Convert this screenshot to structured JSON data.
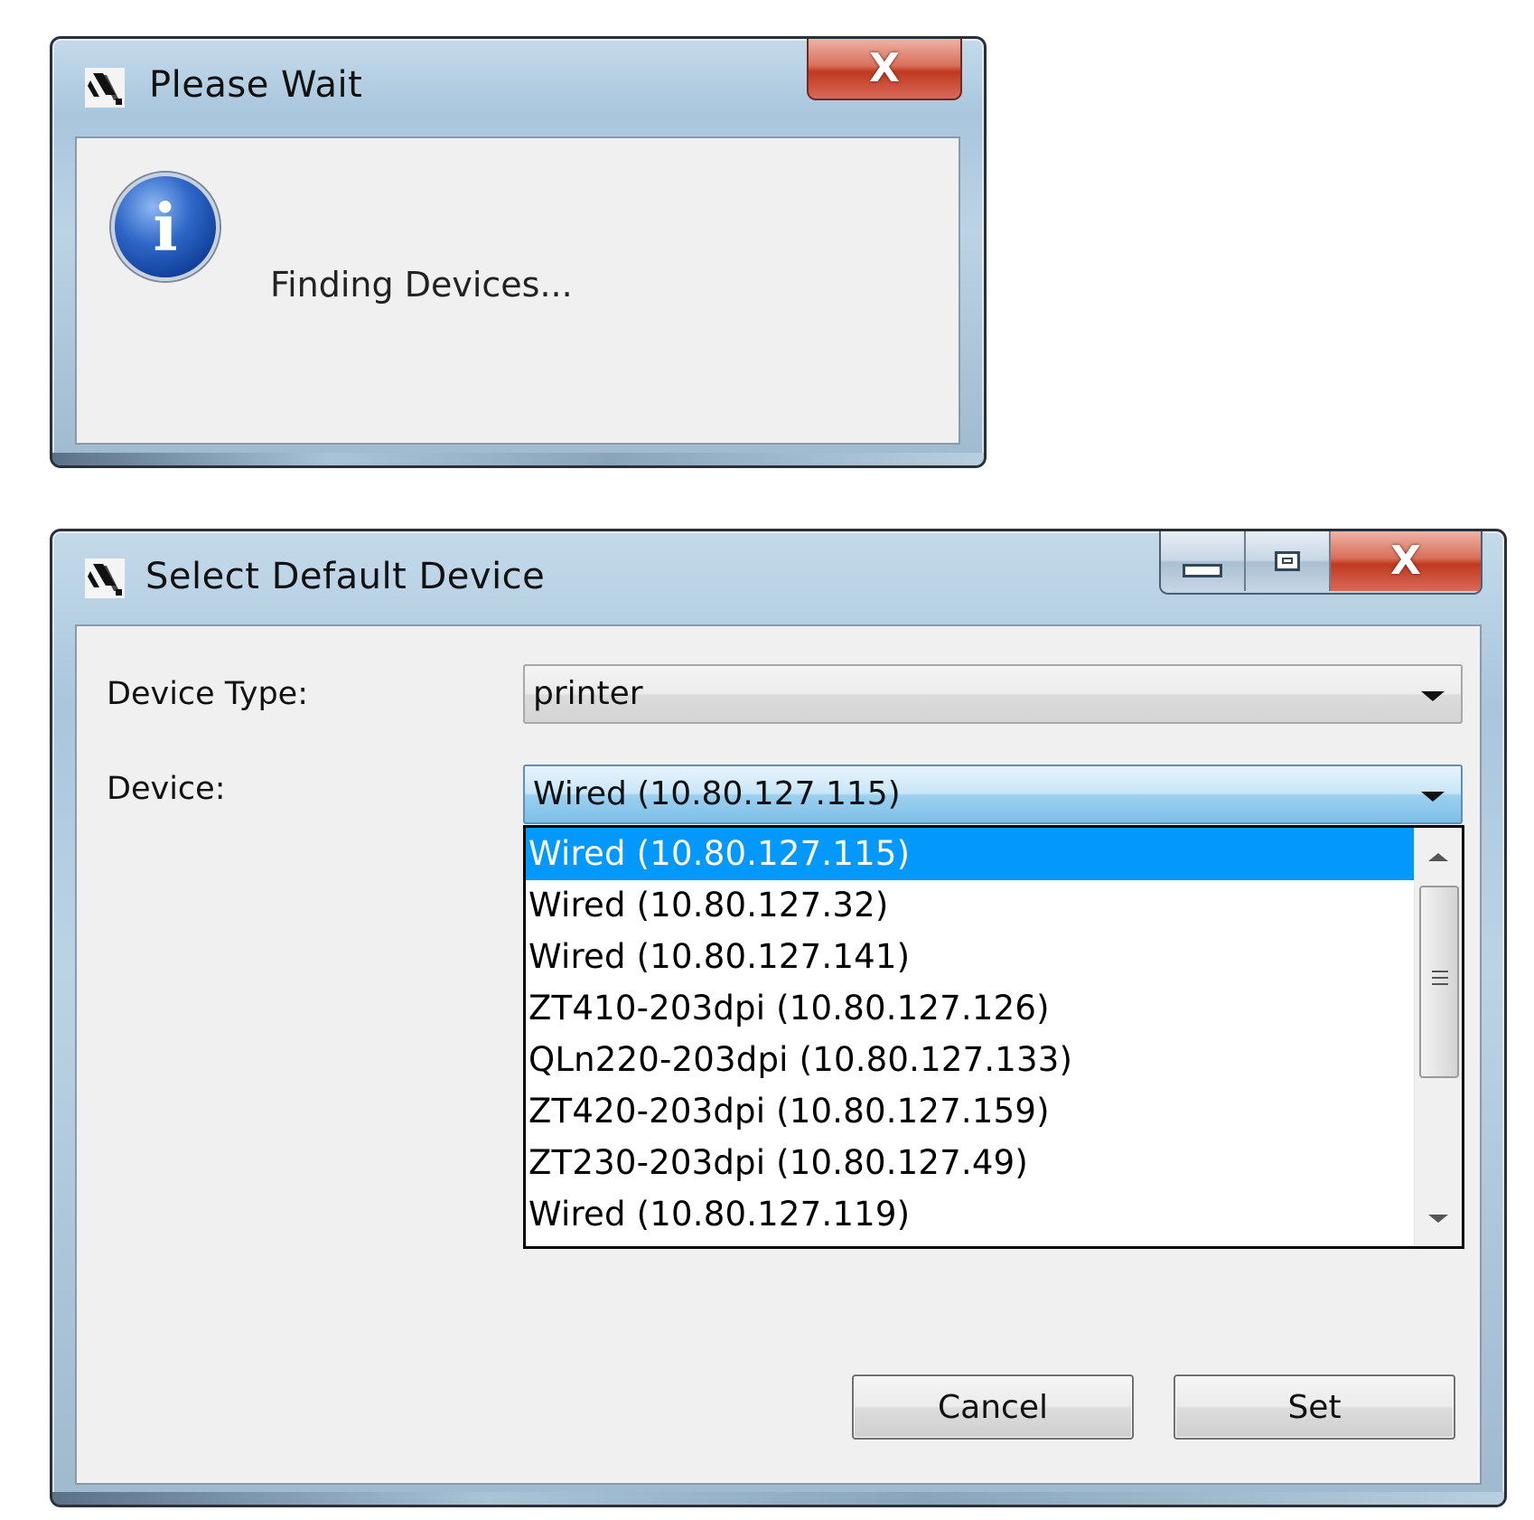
{
  "wait_dialog": {
    "title": "Please Wait",
    "message": "Finding Devices...",
    "close_glyph": "X",
    "icons": [
      "app-icon",
      "info-icon",
      "close-icon"
    ]
  },
  "device_dialog": {
    "title": "Select Default Device",
    "caption_glyph_close": "X",
    "device_type_label": "Device Type:",
    "device_type_value": "printer",
    "device_label": "Device:",
    "device_value": "Wired (10.80.127.115)",
    "device_list": [
      "Wired (10.80.127.115)",
      "Wired (10.80.127.32)",
      "Wired (10.80.127.141)",
      "ZT410-203dpi (10.80.127.126)",
      "QLn220-203dpi (10.80.127.133)",
      "ZT420-203dpi (10.80.127.159)",
      "ZT230-203dpi (10.80.127.49)",
      "Wired (10.80.127.119)"
    ],
    "selected_index": 0,
    "cancel_label": "Cancel",
    "set_label": "Set",
    "colors": {
      "selection": "#0398fc",
      "close_button": "#c0391f",
      "combo_focus": "#9bd0f0"
    }
  }
}
